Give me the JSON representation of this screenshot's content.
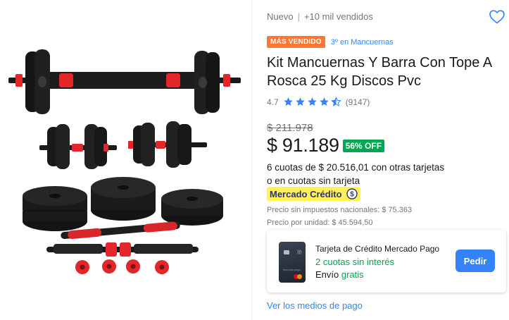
{
  "product": {
    "condition": "Nuevo",
    "separator": "|",
    "sold": "+10 mil vendidos",
    "badge": "MÁS VENDIDO",
    "rank": "3º en Mancuernas",
    "title": "Kit Mancuernas Y Barra Con Tope A Rosca 25 Kg Discos Pvc",
    "rating": {
      "score": "4.7",
      "stars": 4.5,
      "count": "(9147)"
    },
    "original_price": "$ 211.978",
    "price": "$ 91.189",
    "discount": "56% OFF",
    "installments_line1": "6 cuotas de $ 20.516,01 con otras tarjetas",
    "installments_line2": "o en cuotas sin tarjeta",
    "mercado_credito": "Mercado Crédito",
    "tax_note": "Precio sin impuestos nacionales: $ 75.363",
    "unit_price": "Precio por unidad: $ 45.594,50"
  },
  "credit_card_offer": {
    "title": "Tarjeta de Crédito Mercado Pago",
    "installments": "2 cuotas sin interés",
    "shipping_label": "Envío",
    "shipping_value": "gratis",
    "button": "Pedir",
    "card_brand_text": "mercado pago"
  },
  "payment_link": "Ver los medios de pago",
  "colors": {
    "accent_blue": "#3483fa",
    "green": "#00a650",
    "badge_orange": "#ff7733",
    "credit_yellow": "#fff159",
    "dumbbell_red": "#e3262a"
  },
  "icons": {
    "favorite": "heart-outline-icon",
    "star": "star-icon",
    "credit": "mercado-credito-coin-icon"
  }
}
